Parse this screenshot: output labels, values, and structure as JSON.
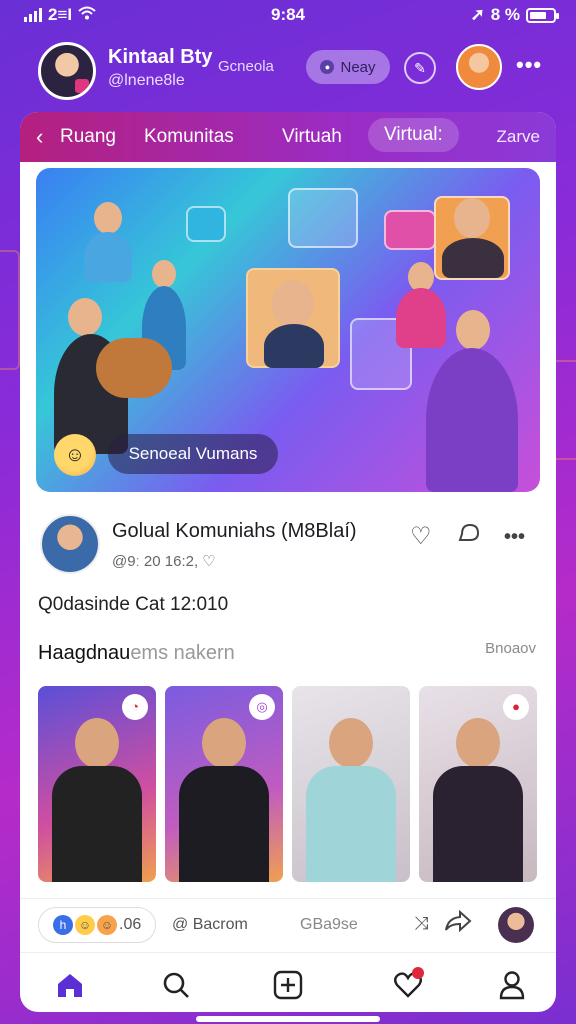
{
  "status_bar": {
    "carrier": "2≡I",
    "time": "9:84",
    "battery": "8 %"
  },
  "profile": {
    "name": "Kintaal Bty",
    "handle": "@lnene8le",
    "extra": "Gcneola",
    "pill_label": "Neay"
  },
  "tabs": {
    "items": [
      "Ruang",
      "Komunitas",
      "Virtuah",
      "Virtual:"
    ],
    "save_label": "Zarve"
  },
  "hero": {
    "caption": "Senoeal Vumans"
  },
  "post": {
    "title": "Golual Komuniahs (M8Blaí)",
    "meta": "@9ː 20 16:2, ♡",
    "text": "Q0dasinde Cat 12:010"
  },
  "section": {
    "title_main": "Haagdnau",
    "title_faint": "ems nakern",
    "link": "Bnoaov"
  },
  "footer": {
    "reaction_count": ".06",
    "comment_label": "@ Bacrom",
    "share_label": "GBa9se"
  },
  "icons": {
    "back": "chevron-left-icon",
    "like": "heart-icon",
    "comment": "bubble-icon",
    "more": "more-icon",
    "home": "home-icon",
    "search": "search-icon",
    "create": "plus-square-icon",
    "activity": "heart-icon",
    "profile": "user-icon"
  },
  "colors": {
    "accent": "#5b2fd6",
    "tab_bar": "#b4207e",
    "notification": "#e0263b"
  }
}
